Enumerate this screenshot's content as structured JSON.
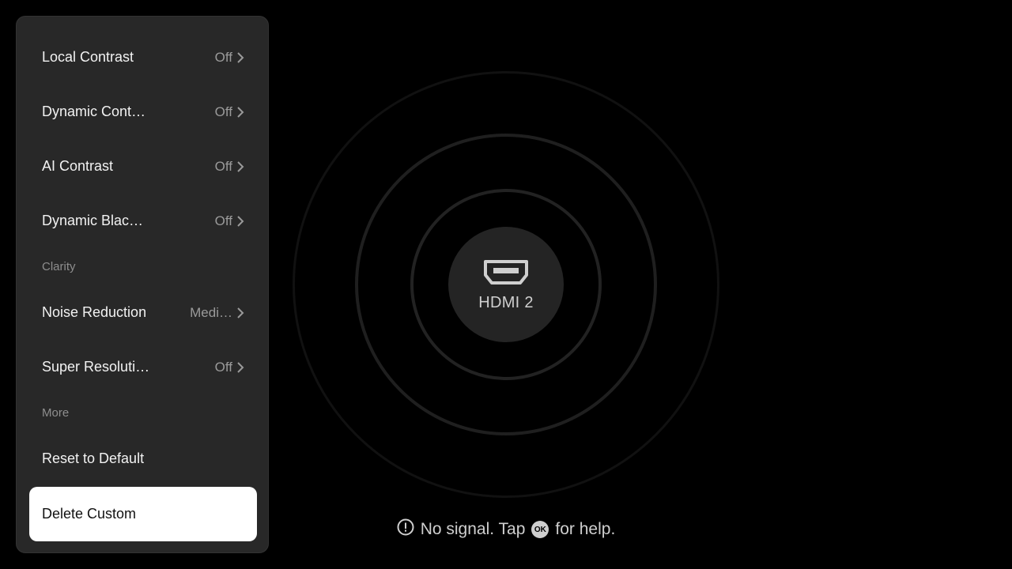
{
  "panel": {
    "items": [
      {
        "label": "Local Contrast",
        "value": "Off"
      },
      {
        "label": "Dynamic Cont…",
        "value": "Off"
      },
      {
        "label": "AI Contrast",
        "value": "Off"
      },
      {
        "label": "Dynamic Blac…",
        "value": "Off"
      }
    ],
    "section_clarity": "Clarity",
    "clarity_items": [
      {
        "label": "Noise Reduction",
        "value": "Medi…"
      },
      {
        "label": "Super Resoluti…",
        "value": "Off"
      }
    ],
    "section_more": "More",
    "more_items": [
      {
        "label": "Reset to Default"
      },
      {
        "label": "Delete Custom",
        "selected": true
      }
    ]
  },
  "source": {
    "label": "HDMI 2",
    "icon": "hdmi-port-icon"
  },
  "hint": {
    "before": "No signal. Tap",
    "ok_key": "OK",
    "after": "for help.",
    "icon": "info-icon"
  },
  "colors": {
    "background": "#000000",
    "panel": "#282828",
    "selected": "#ffffff"
  }
}
